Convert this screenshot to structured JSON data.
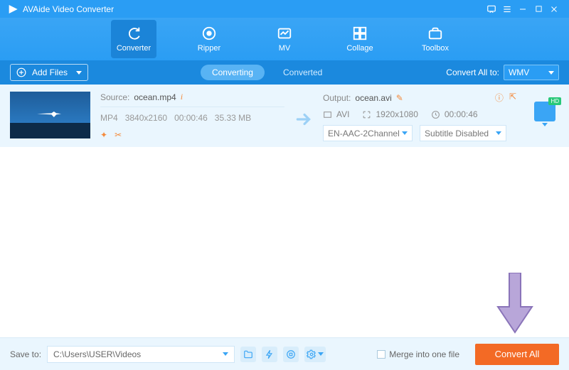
{
  "app": {
    "title": "AVAide Video Converter"
  },
  "nav": {
    "items": [
      {
        "label": "Converter"
      },
      {
        "label": "Ripper"
      },
      {
        "label": "MV"
      },
      {
        "label": "Collage"
      },
      {
        "label": "Toolbox"
      }
    ]
  },
  "toolbar": {
    "add_files": "Add Files",
    "converting": "Converting",
    "converted": "Converted",
    "convert_all_to_label": "Convert All to:",
    "convert_all_to_value": "WMV"
  },
  "item": {
    "source_label": "Source:",
    "source_file": "ocean.mp4",
    "format": "MP4",
    "resolution": "3840x2160",
    "duration": "00:00:46",
    "size": "35.33 MB",
    "output_label": "Output:",
    "output_file": "ocean.avi",
    "out_format": "AVI",
    "out_resolution": "1920x1080",
    "out_duration": "00:00:46",
    "audio_value": "EN-AAC-2Channel",
    "subtitle_value": "Subtitle Disabled"
  },
  "footer": {
    "save_to_label": "Save to:",
    "save_path": "C:\\Users\\USER\\Videos",
    "merge_label": "Merge into one file",
    "convert_button": "Convert All"
  }
}
